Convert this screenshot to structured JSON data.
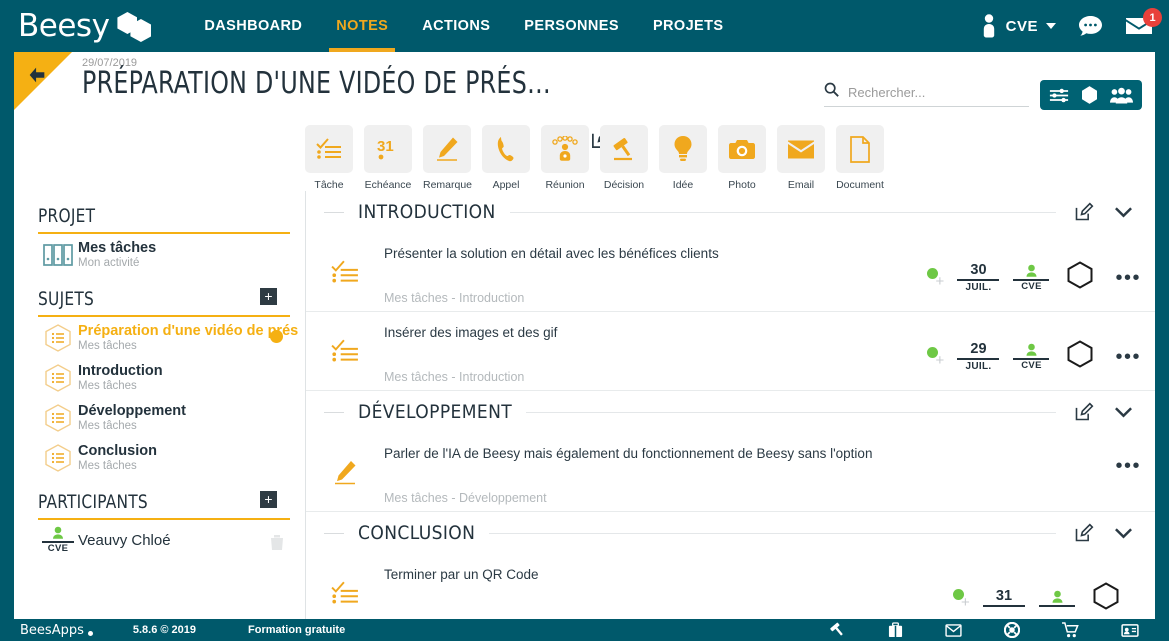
{
  "colors": {
    "teal": "#00596b",
    "yellow": "#f5b013",
    "accent_nav": "#f0a81e",
    "badge_red": "#e8413b",
    "green": "#6ec845",
    "text_dark": "#23323c",
    "muted": "#a4a9ac"
  },
  "topnav": {
    "brand": "Beesy",
    "links": [
      {
        "label": "DASHBOARD",
        "active": false
      },
      {
        "label": "NOTES",
        "active": true
      },
      {
        "label": "ACTIONS",
        "active": false
      },
      {
        "label": "PERSONNES",
        "active": false
      },
      {
        "label": "PROJETS",
        "active": false
      }
    ],
    "user": {
      "initials": "CVE",
      "icon": "user-avatar-icon"
    },
    "chat_icon": "chat-bubble-icon",
    "mail_icon": "envelope-icon",
    "mail_badge": "1"
  },
  "title": {
    "date": "29/07/2019",
    "heading": "PRÉPARATION D'UNE VIDÉO DE PRÉS…",
    "back_icon": "back-arrow-icon",
    "edit_icon": "edit-pencil-icon"
  },
  "search": {
    "placeholder": "Rechercher...",
    "value": "",
    "icon": "search-icon"
  },
  "header_buttons": [
    {
      "name": "filters-button",
      "icon": "sliders-icon"
    },
    {
      "name": "export-button",
      "icon": "hexagon-drop-icon"
    },
    {
      "name": "share-users-button",
      "icon": "users-group-icon"
    }
  ],
  "typebar": [
    {
      "label": "Tâche",
      "icon": "checklist-icon"
    },
    {
      "label": "Echéance",
      "icon": "calendar-31-icon"
    },
    {
      "label": "Remarque",
      "icon": "pencil-icon"
    },
    {
      "label": "Appel",
      "icon": "phone-icon"
    },
    {
      "label": "Réunion",
      "icon": "meeting-icon"
    },
    {
      "label": "Décision",
      "icon": "gavel-icon"
    },
    {
      "label": "Idée",
      "icon": "lightbulb-icon"
    },
    {
      "label": "Photo",
      "icon": "camera-icon"
    },
    {
      "label": "Email",
      "icon": "envelope-icon"
    },
    {
      "label": "Document",
      "icon": "document-icon"
    }
  ],
  "sidebar": {
    "projet": {
      "heading": "PROJET",
      "item": {
        "title": "Mes tâches",
        "subtitle": "Mon activité",
        "icon": "binders-icon"
      }
    },
    "sujets": {
      "heading": "SUJETS",
      "add_label": "+",
      "items": [
        {
          "title": "Préparation d'une vidéo de prés",
          "subtitle": "Mes tâches",
          "icon": "list-hex-icon",
          "selected": true
        },
        {
          "title": "Introduction",
          "subtitle": "Mes tâches",
          "icon": "list-hex-icon",
          "selected": false
        },
        {
          "title": "Développement",
          "subtitle": "Mes tâches",
          "icon": "list-hex-icon",
          "selected": false
        },
        {
          "title": "Conclusion",
          "subtitle": "Mes tâches",
          "icon": "list-hex-icon",
          "selected": false
        }
      ]
    },
    "participants": {
      "heading": "PARTICIPANTS",
      "add_label": "+",
      "items": [
        {
          "name": "Veauvy Chloé",
          "initials": "CVE",
          "icon": "user-avatar-icon"
        }
      ]
    }
  },
  "sections": [
    {
      "title": "INTRODUCTION",
      "edit_icon": "edit-pencil-icon",
      "collapse_icon": "chevron-down-icon",
      "rows": [
        {
          "icon": "checklist-icon",
          "text": "Présenter la solution en détail avec les bénéfices clients",
          "subtitle": "Mes tâches - Introduction",
          "status": "green",
          "date_day": "30",
          "date_month": "JUIL.",
          "assignee": "CVE",
          "hex_icon": "hexagon-outline-icon",
          "menu_icon": "kebab-menu-icon",
          "has_meta": true
        },
        {
          "icon": "checklist-icon",
          "text": "Insérer des images et des gif",
          "subtitle": "Mes tâches - Introduction",
          "status": "green",
          "date_day": "29",
          "date_month": "JUIL.",
          "assignee": "CVE",
          "hex_icon": "hexagon-outline-icon",
          "menu_icon": "kebab-menu-icon",
          "has_meta": true
        }
      ]
    },
    {
      "title": "DÉVELOPPEMENT",
      "edit_icon": "edit-pencil-icon",
      "collapse_icon": "chevron-down-icon",
      "rows": [
        {
          "icon": "pencil-icon",
          "text": "Parler de l'IA de Beesy mais également du fonctionnement de Beesy sans l'option",
          "subtitle": "Mes tâches - Développement",
          "status": "",
          "date_day": "",
          "date_month": "",
          "assignee": "",
          "hex_icon": "",
          "menu_icon": "kebab-menu-icon",
          "has_meta": false
        }
      ]
    },
    {
      "title": "CONCLUSION",
      "edit_icon": "edit-pencil-icon",
      "collapse_icon": "chevron-down-icon",
      "rows": [
        {
          "icon": "checklist-icon",
          "text": "Terminer par un QR Code",
          "subtitle": "",
          "status": "green",
          "date_day": "31",
          "date_month": "",
          "assignee": "",
          "hex_icon": "hexagon-outline-icon",
          "menu_icon": "",
          "has_meta": true
        }
      ]
    }
  ],
  "footer": {
    "brand": "BeesApps",
    "version": "5.8.6 © 2019",
    "offer": "Formation gratuite",
    "icons": [
      {
        "name": "gavel-icon"
      },
      {
        "name": "briefcase-icon"
      },
      {
        "name": "envelope-icon"
      },
      {
        "name": "lifebuoy-help-icon"
      },
      {
        "name": "shopping-cart-icon"
      },
      {
        "name": "id-card-icon"
      }
    ]
  }
}
